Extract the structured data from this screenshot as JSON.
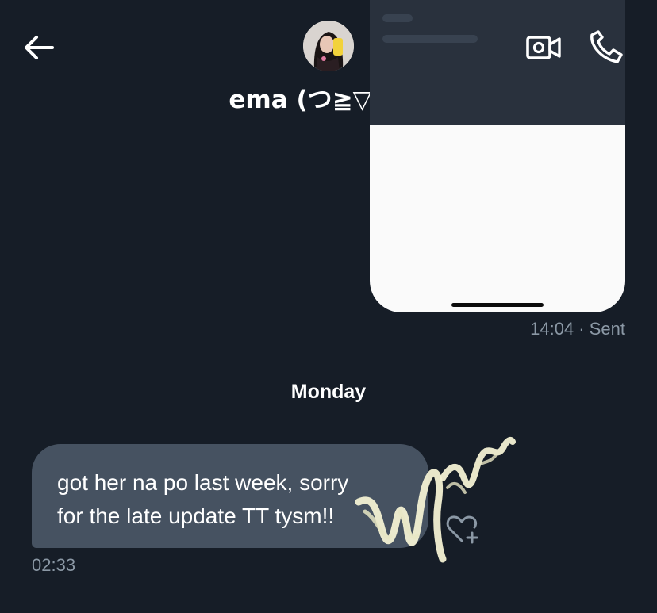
{
  "header": {
    "back_icon": "arrow-left-icon",
    "contact_name": "ema (つ≧▽≦)つ",
    "video_call_icon": "video-camera-icon",
    "voice_call_icon": "phone-icon"
  },
  "messages": {
    "sent_image": {
      "time": "14:04",
      "status": "· Sent"
    },
    "day_divider": "Monday",
    "received": {
      "line1": "got her na po last week, sorry",
      "line2": "for the late update TT tysm!!",
      "time": "02:33",
      "react_icon": "heart-plus-icon"
    }
  },
  "colors": {
    "background": "#161d27",
    "received_bubble": "#465261",
    "muted_text": "#8b98a5"
  }
}
